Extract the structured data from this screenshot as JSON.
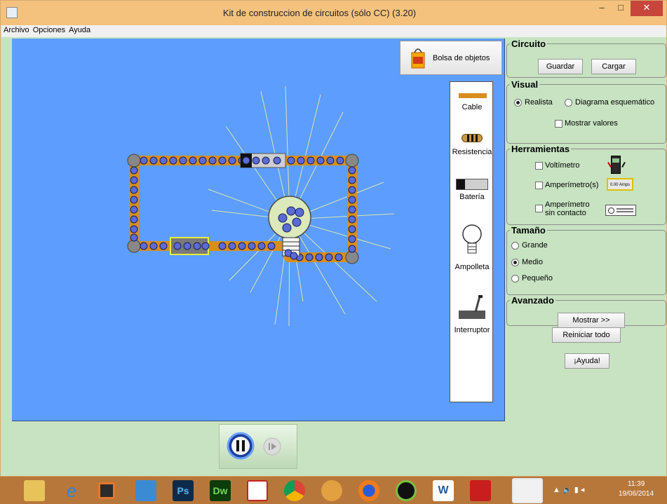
{
  "window": {
    "title": "Kit de construccion de circuitos (sólo CC) (3.20)",
    "minimize": "–",
    "maximize": "□",
    "close": "✕"
  },
  "menu": [
    "Archivo",
    "Opciones",
    "Ayuda"
  ],
  "canvas": {
    "bag_button": "Bolsa de objetos",
    "toolbox": [
      "Cable",
      "Resistencia",
      "Batería",
      "Ampolleta",
      "Interruptor"
    ]
  },
  "panel": {
    "circuito": {
      "title": "Circuito",
      "save": "Guardar",
      "load": "Cargar"
    },
    "visual": {
      "title": "Visual",
      "realista": "Realista",
      "esquematico": "Diagrama esquemático",
      "mostrar_valores": "Mostrar valores",
      "selected": "Realista"
    },
    "herramientas": {
      "title": "Herramientas",
      "voltimetro": "Voltímetro",
      "amperimetro": "Amperímetro(s)",
      "sin_contacto_1": "Amperímetro",
      "sin_contacto_2": "sin contacto",
      "amps_readout": "0.00 Amps"
    },
    "tamano": {
      "title": "Tamaño",
      "grande": "Grande",
      "medio": "Medio",
      "pequeno": "Pequeño",
      "selected": "Medio"
    },
    "avanzado": {
      "title": "Avanzado",
      "mostrar": "Mostrar >>"
    },
    "reiniciar": "Reiniciar todo",
    "ayuda": "¡Ayuda!"
  },
  "taskbar": {
    "apps": [
      "file-explorer-icon",
      "internet-explorer-icon",
      "media-player-icon",
      "control-panel-icon",
      "photoshop-icon",
      "dreamweaver-icon",
      "acrobat-icon",
      "chrome-icon",
      "gimp-icon",
      "firefox-icon",
      "spotify-icon",
      "word-icon",
      "acrobat-reader-icon",
      "java-icon"
    ],
    "ps_label": "Ps",
    "dw_label": "Dw",
    "w_label": "W",
    "time": "11:39",
    "date": "19/06/2014"
  },
  "colors": {
    "canvas": "#5c9dfd",
    "panel": "#c7e3c1",
    "titlebar": "#f4c27d",
    "taskbar": "#b8773a",
    "wire": "#d98e1c"
  }
}
